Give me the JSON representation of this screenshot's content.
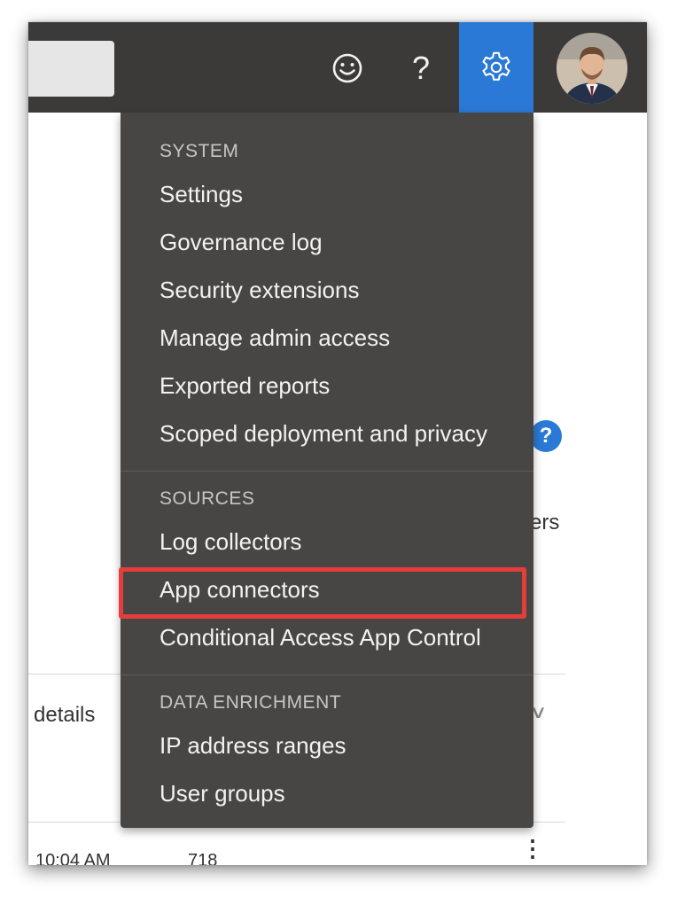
{
  "topbar": {
    "icons": [
      "smiley-icon",
      "help-icon",
      "gear-icon",
      "avatar"
    ],
    "help_glyph": "?",
    "accent": "#2b79d6"
  },
  "background": {
    "help_badge": "?",
    "partial_text": "ers",
    "details_label": "details",
    "row_time": "10:04 AM",
    "row_count": "718",
    "more_glyph": "⋮"
  },
  "menu": {
    "system": {
      "heading": "SYSTEM",
      "items": [
        "Settings",
        "Governance log",
        "Security extensions",
        "Manage admin access",
        "Exported reports",
        "Scoped deployment and privacy"
      ]
    },
    "sources": {
      "heading": "SOURCES",
      "items": [
        "Log collectors",
        "App connectors",
        "Conditional Access App Control"
      ]
    },
    "enrichment": {
      "heading": "DATA ENRICHMENT",
      "items": [
        "IP address ranges",
        "User groups"
      ]
    },
    "highlight_color": "#e53c3c"
  }
}
